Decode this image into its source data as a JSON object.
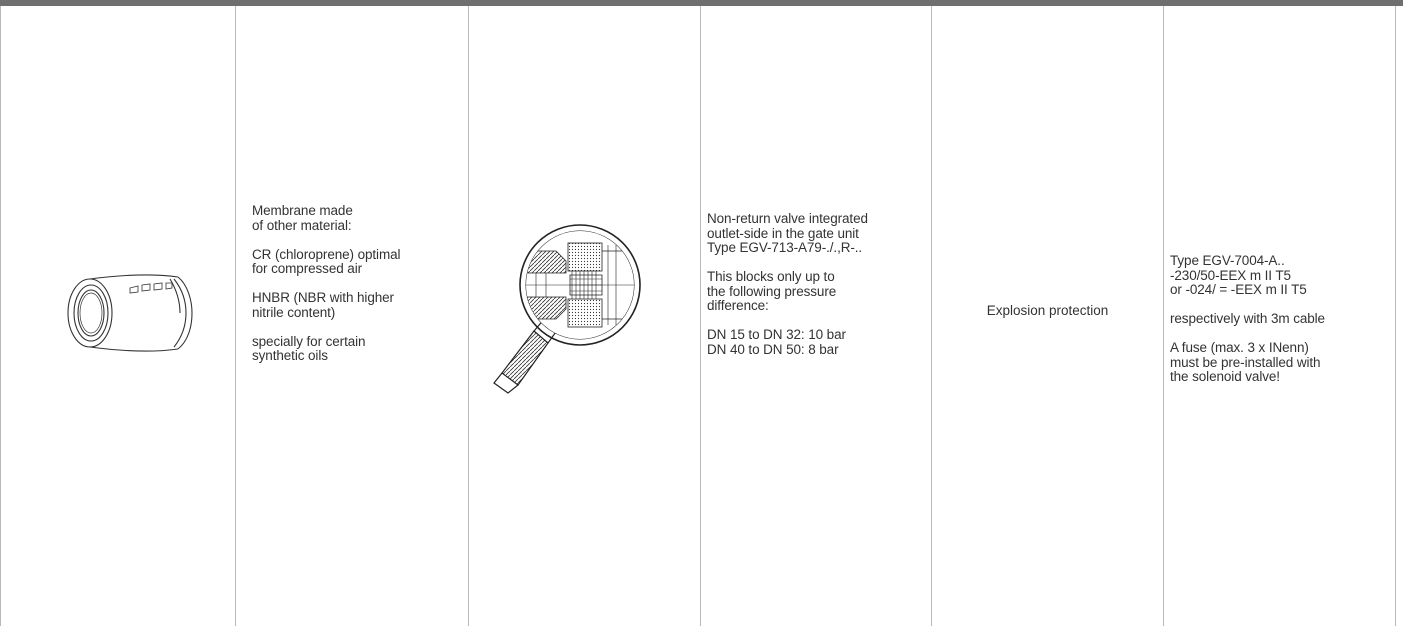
{
  "table": {
    "columns": [
      {
        "type": "image",
        "icon": "membrane-icon"
      },
      {
        "type": "text",
        "paragraphs": [
          "Membrane made\nof other material:",
          "CR (chloroprene) optimal\nfor compressed air",
          "HNBR (NBR with higher\nnitrile content)",
          "specially for certain\nsynthetic oils"
        ]
      },
      {
        "type": "image",
        "icon": "magnified-valve-detail-icon"
      },
      {
        "type": "text",
        "paragraphs": [
          "Non-return valve integrated\noutlet-side in the gate unit\nType EGV-713-A79-./.,R-..",
          "This blocks only up to\nthe following pressure\ndifference:",
          "DN 15 to DN 32: 10 bar\nDN 40 to DN 50: 8 bar"
        ]
      },
      {
        "type": "text",
        "label": "Explosion protection"
      },
      {
        "type": "text",
        "paragraphs": [
          "Type EGV-7004-A..\n    -230/50-EEX m II T5\nor -024/ = -EEX m II T5",
          "respectively with 3m cable",
          "A fuse (max. 3 x INenn)\nmust be pre-installed with\nthe solenoid valve!"
        ]
      }
    ]
  },
  "colors": {
    "header_bar": "#6f6f6f",
    "divider": "#b8b8b8",
    "text": "#333333"
  }
}
